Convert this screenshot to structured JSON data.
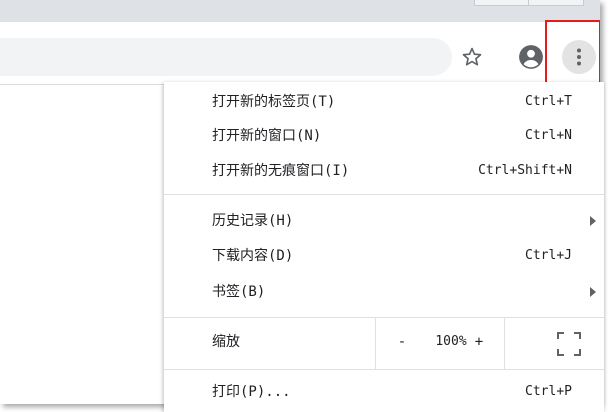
{
  "menu": {
    "items": [
      {
        "label": "打开新的标签页(T)",
        "shortcut": "Ctrl+T"
      },
      {
        "label": "打开新的窗口(N)",
        "shortcut": "Ctrl+N"
      },
      {
        "label": "打开新的无痕窗口(I)",
        "shortcut": "Ctrl+Shift+N"
      },
      {
        "label": "历史记录(H)",
        "shortcut": ""
      },
      {
        "label": "下载内容(D)",
        "shortcut": "Ctrl+J"
      },
      {
        "label": "书签(B)",
        "shortcut": ""
      },
      {
        "label": "打印(P)...",
        "shortcut": "Ctrl+P"
      }
    ],
    "zoom": {
      "label": "缩放",
      "minus": "-",
      "value": "100%",
      "plus": "+"
    }
  },
  "icons": {
    "star": "star-icon",
    "profile": "account-circle-icon",
    "menu": "more-vert-icon",
    "fullscreen": "fullscreen-icon",
    "submenu": "chevron-right-icon"
  },
  "colors": {
    "highlight": "#e81b1b",
    "toolbar_icon": "#5f6368",
    "menu_text": "#202124"
  }
}
